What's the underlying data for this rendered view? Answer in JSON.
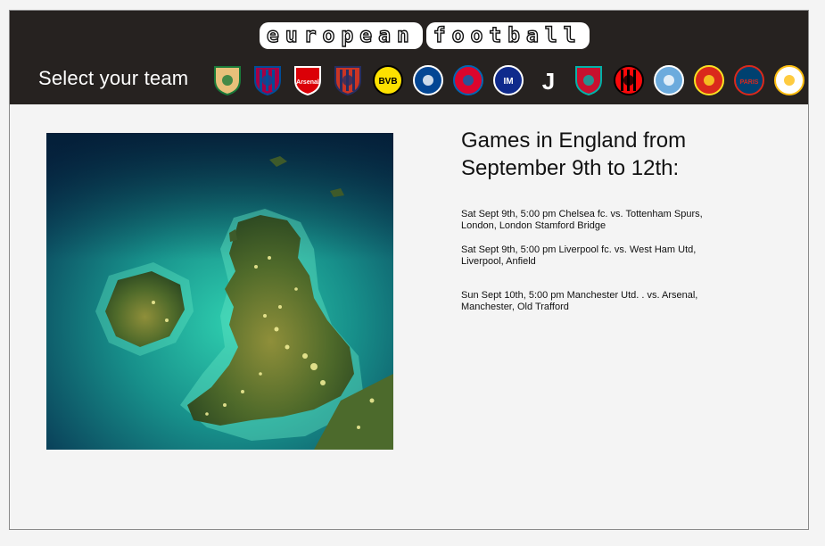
{
  "header": {
    "logo_words": [
      "european",
      "football"
    ],
    "select_label": "Select your team",
    "teams": [
      {
        "name": "Elche",
        "bg": "#e8c07a",
        "fg": "#1a7a3a",
        "shape": "shield",
        "mark": ""
      },
      {
        "name": "Barcelona",
        "bg": "#a50044",
        "fg": "#004d98",
        "shape": "shield-stripe",
        "mark": ""
      },
      {
        "name": "Arsenal",
        "bg": "#db0007",
        "fg": "#ffffff",
        "shape": "shield",
        "mark": "Arsenal"
      },
      {
        "name": "Atletico Madrid",
        "bg": "#cb3524",
        "fg": "#272e61",
        "shape": "shield-stripe",
        "mark": ""
      },
      {
        "name": "Borussia Dortmund",
        "bg": "#fde100",
        "fg": "#000000",
        "shape": "circle",
        "mark": "BVB"
      },
      {
        "name": "Chelsea",
        "bg": "#034694",
        "fg": "#ffffff",
        "shape": "circle",
        "mark": ""
      },
      {
        "name": "Bayern Munchen",
        "bg": "#dc052d",
        "fg": "#0066b2",
        "shape": "circle",
        "mark": ""
      },
      {
        "name": "Inter",
        "bg": "#0f2a8c",
        "fg": "#ffffff",
        "shape": "circle",
        "mark": "IM"
      },
      {
        "name": "Juventus",
        "bg": "#262220",
        "fg": "#ffffff",
        "shape": "text",
        "mark": "J"
      },
      {
        "name": "Liverpool",
        "bg": "#c8102e",
        "fg": "#00b2a9",
        "shape": "shield",
        "mark": ""
      },
      {
        "name": "AC Milan",
        "bg": "#fb090b",
        "fg": "#000000",
        "shape": "circle-stripe",
        "mark": ""
      },
      {
        "name": "Manchester City",
        "bg": "#6cabdd",
        "fg": "#ffffff",
        "shape": "circle",
        "mark": ""
      },
      {
        "name": "Manchester United",
        "bg": "#da291c",
        "fg": "#fbe122",
        "shape": "circle",
        "mark": ""
      },
      {
        "name": "Paris Saint-Germain",
        "bg": "#004170",
        "fg": "#da291c",
        "shape": "circle",
        "mark": "PARIS"
      },
      {
        "name": "Real Madrid",
        "bg": "#ffffff",
        "fg": "#febe10",
        "shape": "circle",
        "mark": ""
      }
    ]
  },
  "main": {
    "heading_line1": "Games in England from",
    "heading_line2": "September 9th to 12th:",
    "games": [
      {
        "line1": "Sat Sept 9th, 5:00 pm Chelsea fc. vs. Tottenham Spurs,",
        "line2": "London, London Stamford Bridge"
      },
      {
        "line1": "Sat Sept 9th, 5:00 pm Liverpool fc. vs. West Ham Utd,",
        "line2": "Liverpool, Anfield"
      },
      {
        "line1": "Sun Sept 10th, 5:00 pm Manchester Utd. . vs. Arsenal,",
        "line2": "Manchester, Old Trafford"
      }
    ]
  },
  "colors": {
    "header_bg": "#262220",
    "page_bg": "#f4f4f4",
    "sea_deep": "#0a3f6b",
    "sea_shallow": "#22b89a",
    "land": "#3f5d2a"
  }
}
